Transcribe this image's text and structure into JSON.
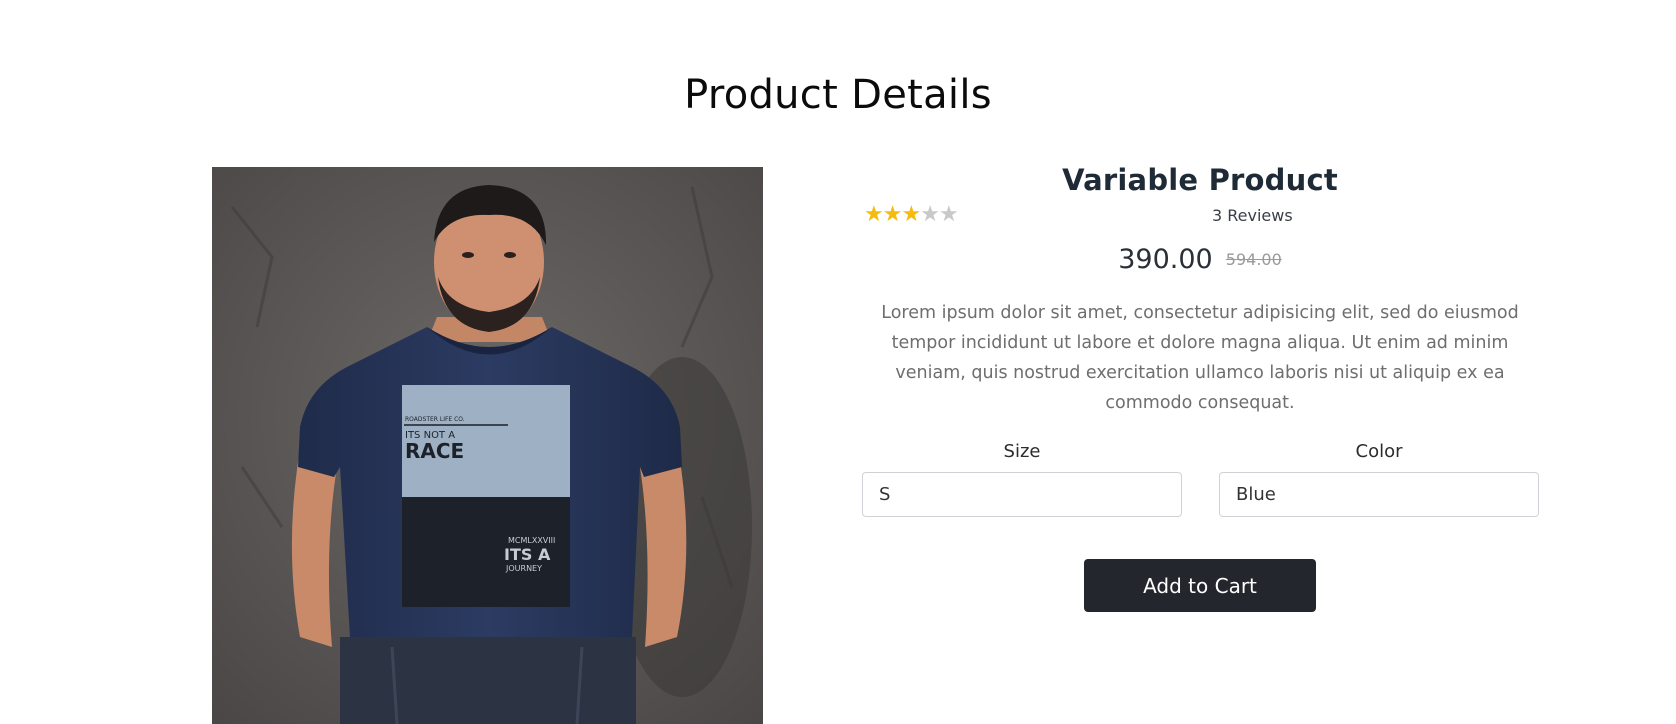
{
  "page": {
    "title": "Product Details"
  },
  "product": {
    "name": "Variable Product",
    "rating": 3,
    "rating_max": 5,
    "reviews_label": "3 Reviews",
    "price": "390.00",
    "old_price": "594.00",
    "description": "Lorem ipsum dolor sit amet, consectetur adipisicing elit, sed do eiusmod tempor incididunt ut labore et dolore magna aliqua. Ut enim ad minim veniam, quis nostrud exercitation ullamco laboris nisi ut aliquip ex ea commodo consequat.",
    "image": {
      "shirt_print_top": "ITS NOT A",
      "shirt_print_big": "RACE",
      "shirt_print_small": "ROADSTER LIFE CO.",
      "shirt_print_mid": "MCMLXXVIII",
      "shirt_print_bottom_big": "ITS A",
      "shirt_print_bottom_small": "JOURNEY"
    }
  },
  "options": {
    "size": {
      "label": "Size",
      "selected": "S"
    },
    "color": {
      "label": "Color",
      "selected": "Blue"
    }
  },
  "actions": {
    "add_to_cart_label": "Add to Cart"
  },
  "colors": {
    "star_filled": "#f5bb10",
    "star_empty": "#c9c9c9",
    "button_bg": "#23272d",
    "shirt": "#28365a"
  },
  "icons": {
    "star_filled": "star-filled-icon",
    "star_empty": "star-empty-icon"
  }
}
